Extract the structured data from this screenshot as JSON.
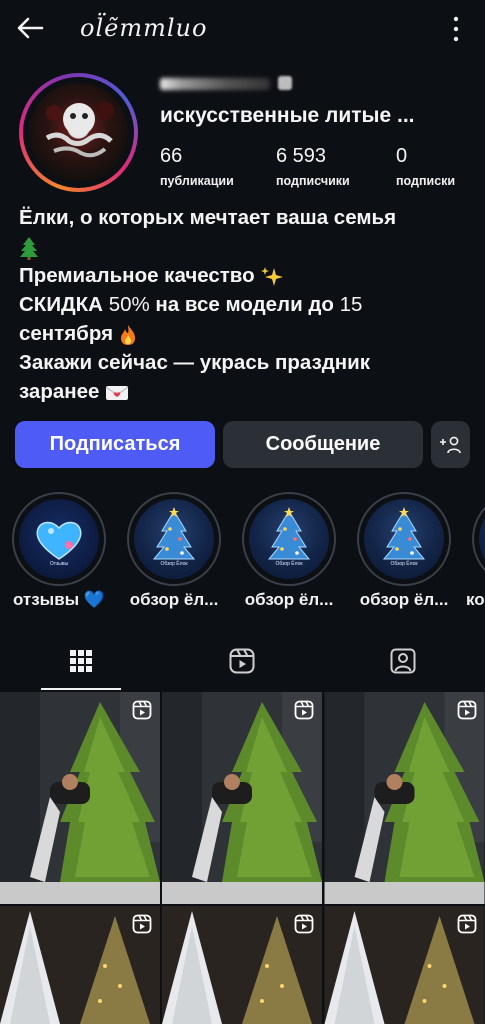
{
  "header": {
    "username": "ol̈ẽmmluo",
    "back_icon": "back-arrow-icon",
    "menu_icon": "more-vertical-icon"
  },
  "profile": {
    "full_name": "искусственные литые ...",
    "stats": [
      {
        "value": "66",
        "label": "публикации"
      },
      {
        "value": "6 593",
        "label": "подписчики"
      },
      {
        "value": "0",
        "label": "подписки"
      }
    ]
  },
  "bio": {
    "line1": "Ёлки, о которых мечтает ваша семья",
    "line2_icon": "christmas-tree-emoji",
    "line3": "Премиальное качество",
    "line3_icon": "sparkles-emoji",
    "line4_a": "СКИДКА",
    "line4_b": "50%",
    "line4_c": "на все модели до",
    "line4_d": "15",
    "line5": "сентября",
    "line5_icon": "fire-emoji",
    "line6": "Закажи сейчас — укрась праздник",
    "line7": "заранее",
    "line7_icon": "love-letter-emoji"
  },
  "actions": {
    "follow": "Подписаться",
    "message": "Сообщение",
    "add_icon": "add-person-icon"
  },
  "highlights": [
    {
      "label": "отзывы 💙",
      "caption": "Отзывы"
    },
    {
      "label": "обзор ёл...",
      "caption": "Обзор Ёлок"
    },
    {
      "label": "обзор ёл...",
      "caption": "Обзор Ёлок"
    },
    {
      "label": "обзор ёл...",
      "caption": "Обзор Ёлок"
    },
    {
      "label": "ко",
      "caption": ""
    }
  ],
  "tabs": [
    {
      "icon": "grid-icon",
      "active": true
    },
    {
      "icon": "reels-icon",
      "active": false
    },
    {
      "icon": "tagged-icon",
      "active": false
    }
  ],
  "colors": {
    "accent": "#4e5bf5",
    "background": "#0c0f14",
    "secondary_button": "#2b2f36"
  }
}
